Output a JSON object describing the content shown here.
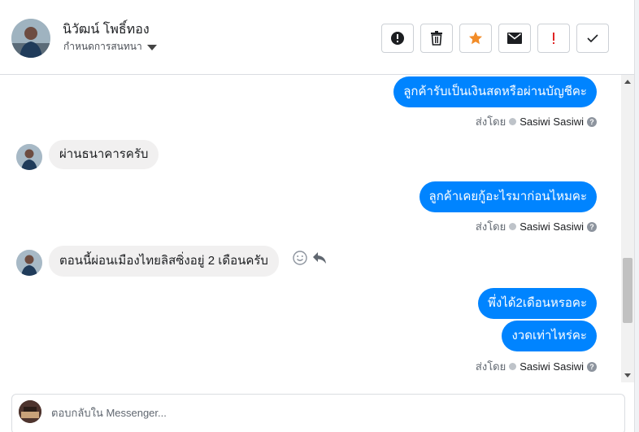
{
  "header": {
    "contact_name": "นิวัฒน์ โพธิ์ทอง",
    "assign_label": "กำหนดการสนทนา",
    "actions": [
      {
        "name": "mark-spam-button",
        "icon": "exclamation-circle-icon"
      },
      {
        "name": "delete-button",
        "icon": "trash-icon"
      },
      {
        "name": "star-button",
        "icon": "star-icon",
        "color": "#f28c28"
      },
      {
        "name": "mark-unread-button",
        "icon": "envelope-icon"
      },
      {
        "name": "follow-up-button",
        "icon": "exclamation-icon",
        "color": "#e02424"
      },
      {
        "name": "mark-done-button",
        "icon": "checkmark-icon"
      }
    ]
  },
  "messages": [
    {
      "type": "out",
      "text": "ลูกค้ารับเป็นเงินสดหรือผ่านบัญชีคะ"
    },
    {
      "type": "meta",
      "prefix": "ส่งโดย",
      "sender": "Sasiwi Sasiwi"
    },
    {
      "type": "in",
      "text": "ผ่านธนาคารครับ"
    },
    {
      "type": "out",
      "text": "ลูกค้าเคยกู้อะไรมาก่อนไหมคะ"
    },
    {
      "type": "meta",
      "prefix": "ส่งโดย",
      "sender": "Sasiwi Sasiwi"
    },
    {
      "type": "in",
      "text": "ตอนนี้ผ่อนเมืองไทยลิสซิ่งอยู่ 2 เดือนครับ"
    },
    {
      "type": "out",
      "text": "พึ่งได้2เดือนหรอคะ"
    },
    {
      "type": "out",
      "text": "งวดเท่าไหร่คะ"
    },
    {
      "type": "meta",
      "prefix": "ส่งโดย",
      "sender": "Sasiwi Sasiwi"
    }
  ],
  "composer": {
    "placeholder": "ตอบกลับใน Messenger..."
  },
  "colors": {
    "outgoing_bubble": "#0084ff",
    "incoming_bubble": "#f1f0f0"
  }
}
